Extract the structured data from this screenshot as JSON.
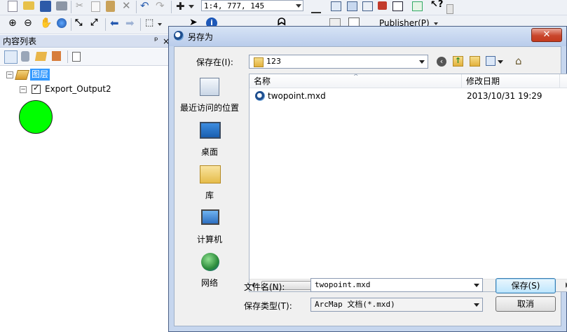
{
  "toolbar": {
    "scale": "1:4, 777, 145",
    "publisher_label": "Publisher(P)"
  },
  "toc": {
    "title": "内容列表",
    "pin_symbol": "ᵖ",
    "close_symbol": "×",
    "layers_label": "图层",
    "layer_name": "Export_Output2",
    "symbol_color": "#00ff00"
  },
  "dialog": {
    "title": "另存为",
    "close_label": "✕",
    "look_in_label": "保存在(I):",
    "look_in_value": "123",
    "places": [
      {
        "label": "最近访问的位置",
        "icon": "recent-places-icon"
      },
      {
        "label": "桌面",
        "icon": "desktop-icon"
      },
      {
        "label": "库",
        "icon": "libraries-icon"
      },
      {
        "label": "计算机",
        "icon": "computer-icon"
      },
      {
        "label": "网络",
        "icon": "network-icon"
      }
    ],
    "columns": {
      "name": "名称",
      "modified": "修改日期"
    },
    "files": [
      {
        "name": "twopoint.mxd",
        "modified": "2013/10/31 19:29"
      }
    ],
    "filename_label": "文件名(N):",
    "filename_value": "twopoint.mxd",
    "filetype_label": "保存类型(T):",
    "filetype_value": "ArcMap 文档(*.mxd)",
    "save_label": "保存(S)",
    "cancel_label": "取消"
  }
}
